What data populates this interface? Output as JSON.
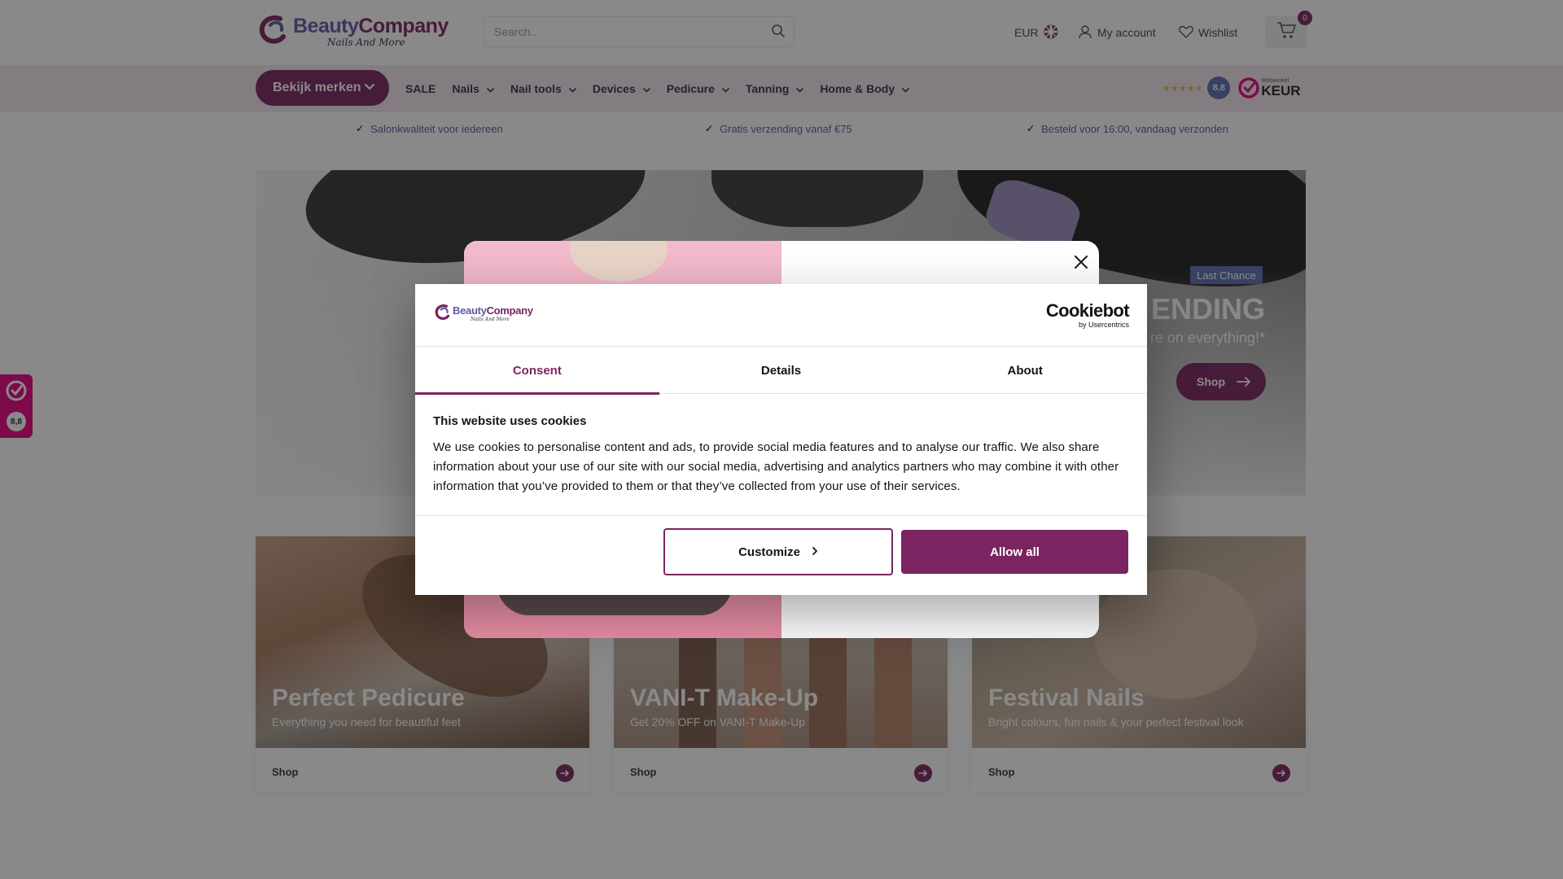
{
  "header": {
    "logo_main_1": "Beauty",
    "logo_main_2": "Company",
    "logo_sub": "Nails And More",
    "search_placeholder": "Search..",
    "currency": "EUR",
    "my_account": "My account",
    "wishlist": "Wishlist",
    "cart_count": "0"
  },
  "nav": {
    "brands_label": "Bekijk merken",
    "items": [
      {
        "label": "SALE",
        "dropdown": false
      },
      {
        "label": "Nails",
        "dropdown": true
      },
      {
        "label": "Nail tools",
        "dropdown": true
      },
      {
        "label": "Devices",
        "dropdown": true
      },
      {
        "label": "Pedicure",
        "dropdown": true
      },
      {
        "label": "Tanning",
        "dropdown": true
      },
      {
        "label": "Home & Body",
        "dropdown": true
      }
    ],
    "rating_score": "8.8",
    "rating_stars": 4,
    "keur_small": "Webwinkel",
    "keur_big": "KEUR"
  },
  "usps": [
    "Salonkwaliteit voor iedereen",
    "Gratis verzending vanaf €75",
    "Besteld voor 16:00, vandaag verzonden"
  ],
  "hero": {
    "badge": "Last Chance",
    "title": "S ENDING",
    "subtitle": "re on everything!*",
    "shop_label": "Shop"
  },
  "cards": [
    {
      "title": "Perfect Pedicure",
      "subtitle": "Everything you need for beautiful feet",
      "shop": "Shop"
    },
    {
      "title": "VANI-T Make-Up",
      "subtitle": "Get 20% OFF on VANI-T Make-Up",
      "shop": "Shop"
    },
    {
      "title": "Festival Nails",
      "subtitle": "Bright colours, fun nails & your perfect festival look",
      "shop": "Shop"
    }
  ],
  "side_widget": {
    "score": "8,8"
  },
  "cookie": {
    "brand_main": "Cookiebot",
    "brand_sub": "by Usercentrics",
    "logo_main_1": "Beauty",
    "logo_main_2": "Company",
    "logo_sub": "Nails And More",
    "tabs": [
      "Consent",
      "Details",
      "About"
    ],
    "active_tab": "Consent",
    "heading": "This website uses cookies",
    "body": "We use cookies to personalise content and ads, to provide social media features and to analyse our traffic. We also share information about your use of our site with our social media, advertising and analytics partners who may combine it with other information that you’ve provided to them or that they’ve collected from your use of their services.",
    "customize_label": "Customize",
    "allow_label": "Allow all"
  },
  "colors": {
    "brand_plum": "#7a2461",
    "brand_blue": "#5a5aa8",
    "nav_bg": "#f3e6ef",
    "star": "#e5b83c"
  }
}
